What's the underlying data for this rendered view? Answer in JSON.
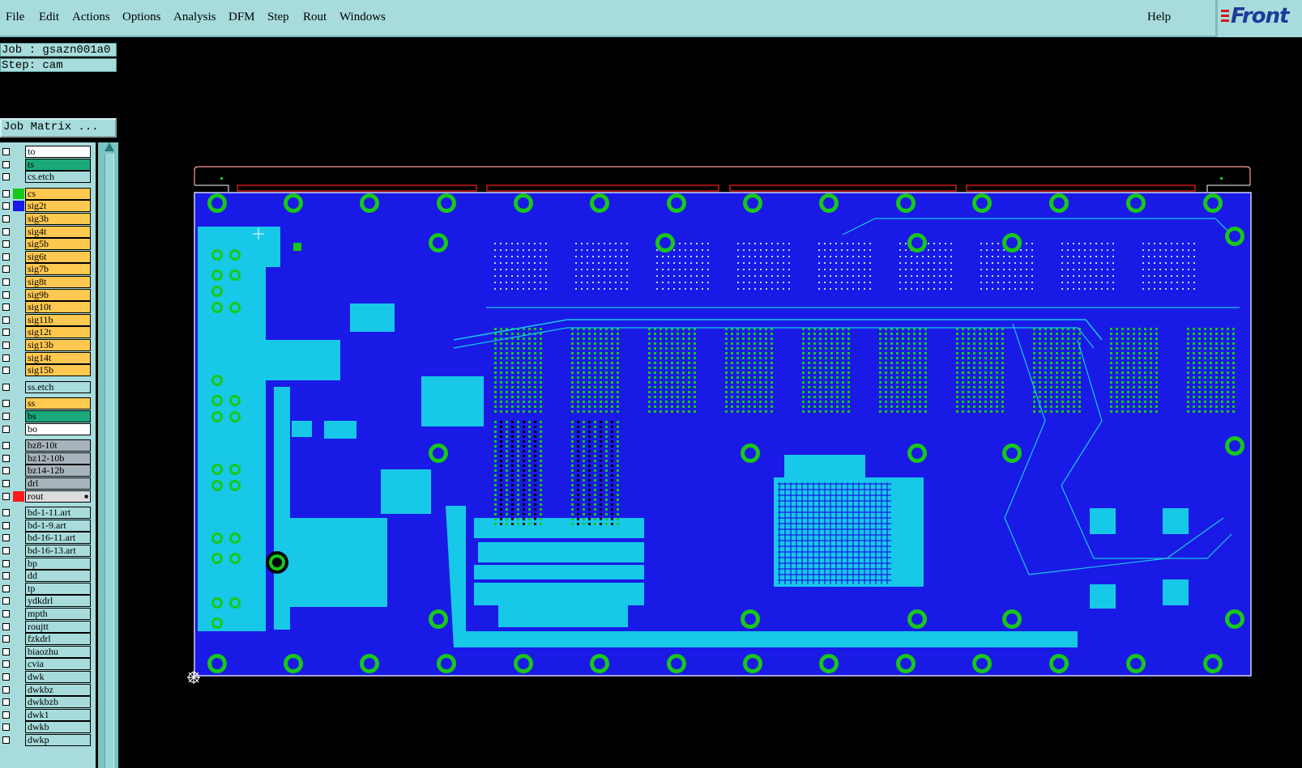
{
  "menubar": {
    "items": [
      {
        "label": "File",
        "name": "menu-file"
      },
      {
        "label": "Edit",
        "name": "menu-edit"
      },
      {
        "label": "Actions",
        "name": "menu-actions"
      },
      {
        "label": "Options",
        "name": "menu-options"
      },
      {
        "label": "Analysis",
        "name": "menu-analysis"
      },
      {
        "label": "DFM",
        "name": "menu-dfm"
      },
      {
        "label": "Step",
        "name": "menu-step"
      },
      {
        "label": "Rout",
        "name": "menu-rout"
      },
      {
        "label": "Windows",
        "name": "menu-windows"
      }
    ],
    "help": "Help",
    "logo": "Front"
  },
  "panel": {
    "job": "Job : gsazn001a0",
    "step": "Step: cam",
    "job_matrix": "Job Matrix ..."
  },
  "colors": {
    "board": "#1a1ae6",
    "copper": "#18c8e8",
    "pad": "#18c818",
    "route": "#ff3030",
    "panel": "#a8dcdc"
  },
  "layers": [
    {
      "name": "to",
      "bg": "#ffffff",
      "swatch": ""
    },
    {
      "name": "ts",
      "bg": "#1aa87a",
      "swatch": ""
    },
    {
      "name": "cs.etch",
      "bg": "#a8dcdc",
      "swatch": ""
    },
    {
      "name": "cs",
      "bg": "#ffc850",
      "swatch": "#18c818"
    },
    {
      "name": "sig2t",
      "bg": "#ffc850",
      "swatch": "#1a1ae6"
    },
    {
      "name": "sig3b",
      "bg": "#ffc850",
      "swatch": ""
    },
    {
      "name": "sig4t",
      "bg": "#ffc850",
      "swatch": ""
    },
    {
      "name": "sig5b",
      "bg": "#ffc850",
      "swatch": ""
    },
    {
      "name": "sig6t",
      "bg": "#ffc850",
      "swatch": ""
    },
    {
      "name": "sig7b",
      "bg": "#ffc850",
      "swatch": ""
    },
    {
      "name": "sig8t",
      "bg": "#ffc850",
      "swatch": ""
    },
    {
      "name": "sig9b",
      "bg": "#ffc850",
      "swatch": ""
    },
    {
      "name": "sig10t",
      "bg": "#ffc850",
      "swatch": ""
    },
    {
      "name": "sig11b",
      "bg": "#ffc850",
      "swatch": ""
    },
    {
      "name": "sig12t",
      "bg": "#ffc850",
      "swatch": ""
    },
    {
      "name": "sig13b",
      "bg": "#ffc850",
      "swatch": ""
    },
    {
      "name": "sig14t",
      "bg": "#ffc850",
      "swatch": ""
    },
    {
      "name": "sig15b",
      "bg": "#ffc850",
      "swatch": ""
    },
    {
      "name": "ss.etch",
      "bg": "#a8dcdc",
      "swatch": ""
    },
    {
      "name": "ss",
      "bg": "#ffc850",
      "swatch": ""
    },
    {
      "name": "bs",
      "bg": "#1aa87a",
      "swatch": ""
    },
    {
      "name": "bo",
      "bg": "#ffffff",
      "swatch": ""
    },
    {
      "name": "bz8-10t",
      "bg": "#a8b4bc",
      "swatch": ""
    },
    {
      "name": "bz12-10b",
      "bg": "#a8b4bc",
      "swatch": ""
    },
    {
      "name": "bz14-12b",
      "bg": "#a8b4bc",
      "swatch": ""
    },
    {
      "name": "drl",
      "bg": "#a8b4bc",
      "swatch": ""
    },
    {
      "name": "rout",
      "bg": "#dcdcdc",
      "swatch": "#ff1a1a",
      "mark": "■"
    },
    {
      "name": "bd-1-11.art",
      "bg": "#a8dcdc",
      "swatch": ""
    },
    {
      "name": "bd-1-9.art",
      "bg": "#a8dcdc",
      "swatch": ""
    },
    {
      "name": "bd-16-11.art",
      "bg": "#a8dcdc",
      "swatch": ""
    },
    {
      "name": "bd-16-13.art",
      "bg": "#a8dcdc",
      "swatch": ""
    },
    {
      "name": "bp",
      "bg": "#a8dcdc",
      "swatch": ""
    },
    {
      "name": "dd",
      "bg": "#a8dcdc",
      "swatch": ""
    },
    {
      "name": "tp",
      "bg": "#a8dcdc",
      "swatch": ""
    },
    {
      "name": "ydkdrl",
      "bg": "#a8dcdc",
      "swatch": ""
    },
    {
      "name": "mpth",
      "bg": "#a8dcdc",
      "swatch": ""
    },
    {
      "name": "roujtt",
      "bg": "#a8dcdc",
      "swatch": ""
    },
    {
      "name": "fzkdrl",
      "bg": "#a8dcdc",
      "swatch": ""
    },
    {
      "name": "biaozhu",
      "bg": "#a8dcdc",
      "swatch": ""
    },
    {
      "name": "cvia",
      "bg": "#a8dcdc",
      "swatch": ""
    },
    {
      "name": "dwk",
      "bg": "#a8dcdc",
      "swatch": ""
    },
    {
      "name": "dwkbz",
      "bg": "#a8dcdc",
      "swatch": ""
    },
    {
      "name": "dwkbzb",
      "bg": "#a8dcdc",
      "swatch": ""
    },
    {
      "name": "dwk1",
      "bg": "#a8dcdc",
      "swatch": ""
    },
    {
      "name": "dwkb",
      "bg": "#a8dcdc",
      "swatch": ""
    },
    {
      "name": "dwkp",
      "bg": "#a8dcdc",
      "swatch": ""
    }
  ]
}
